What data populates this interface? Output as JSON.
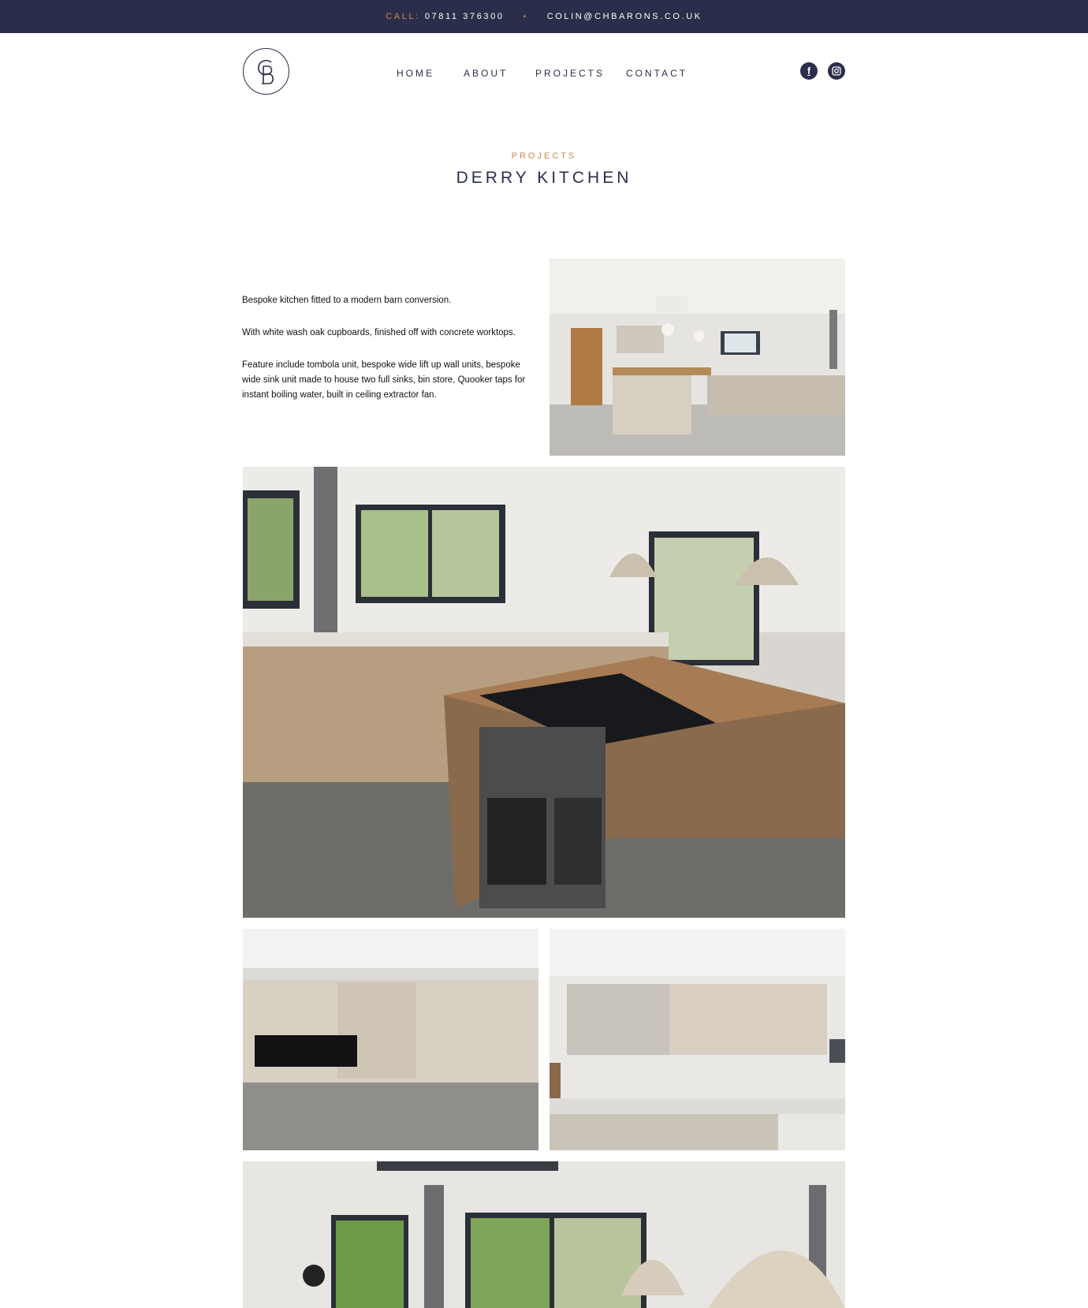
{
  "topbar": {
    "call_label": "CALL:",
    "phone": "07811 376300",
    "separator": "•",
    "email": "COLIN@CHBARONS.CO.UK"
  },
  "logo": {
    "letters": "CB"
  },
  "nav": {
    "items": [
      {
        "label": "HOME"
      },
      {
        "label": "ABOUT"
      },
      {
        "label": "PROJECTS"
      },
      {
        "label": "CONTACT"
      }
    ]
  },
  "social": {
    "facebook_icon": "f",
    "instagram_icon": "instagram"
  },
  "page": {
    "eyebrow": "PROJECTS",
    "title": "DERRY KITCHEN"
  },
  "description": {
    "paragraphs": [
      "Bespoke kitchen fitted to a modern barn conversion.",
      "With white wash oak cupboards, finished off with concrete worktops.",
      "Feature include tombola unit, bespoke wide lift up wall units, bespoke wide sink unit made to house two full sinks, bin store, Quooker taps for instant boiling water, built in ceiling extractor fan."
    ]
  },
  "colors": {
    "navy": "#2b2e4a",
    "accent": "#c8894f"
  }
}
